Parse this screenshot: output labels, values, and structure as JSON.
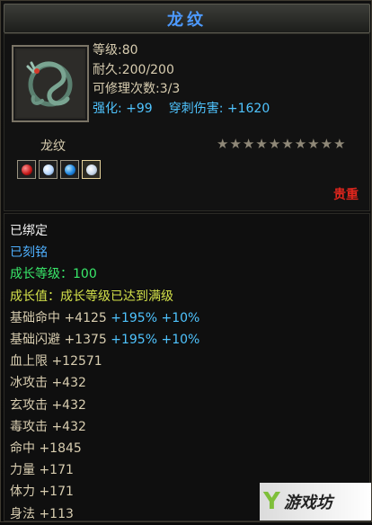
{
  "title": "龙纹",
  "item": {
    "name": "龙纹",
    "icon": "dragon-emblem-icon",
    "level": "等级:80",
    "durability": "耐久:200/200",
    "repair_count": "可修理次数:3/3",
    "enhance": "强化: +99",
    "pierce": "穿刺伤害: +1620",
    "star_count": 10,
    "quality": "贵重"
  },
  "gems": [
    {
      "kind": "red",
      "icon": "red-gem-icon"
    },
    {
      "kind": "white",
      "icon": "white-gem-icon"
    },
    {
      "kind": "blue",
      "icon": "blue-gem-icon"
    },
    {
      "kind": "special",
      "icon": "silver-gem-icon"
    }
  ],
  "attributes": [
    {
      "label": "已绑定",
      "color": "#f2f2f2"
    },
    {
      "label": "已刻铭",
      "color": "#4fb0ff"
    },
    {
      "label": "成长等级：100",
      "color": "#39e86a"
    },
    {
      "label": "成长值：成长等级已达到满级",
      "color": "#d4e24a"
    },
    {
      "label": "基础命中",
      "value": "+4125",
      "bonus": "+195% +10%"
    },
    {
      "label": "基础闪避",
      "value": "+1375",
      "bonus": "+195% +10%"
    },
    {
      "label": "血上限",
      "value": "+12571"
    },
    {
      "label": "冰攻击",
      "value": "+432"
    },
    {
      "label": "玄攻击",
      "value": "+432"
    },
    {
      "label": "毒攻击",
      "value": "+432"
    },
    {
      "label": "命中",
      "value": "+1845"
    },
    {
      "label": "力量",
      "value": "+171"
    },
    {
      "label": "体力",
      "value": "+171"
    },
    {
      "label": "身法",
      "value": "+113"
    }
  ],
  "watermark": {
    "mark": "Y",
    "text": "游戏坊"
  },
  "colors": {
    "title": "#4d9aff",
    "quality": "#e0261d",
    "stat_blue": "#4fc4ff",
    "star": "#8f8878"
  }
}
